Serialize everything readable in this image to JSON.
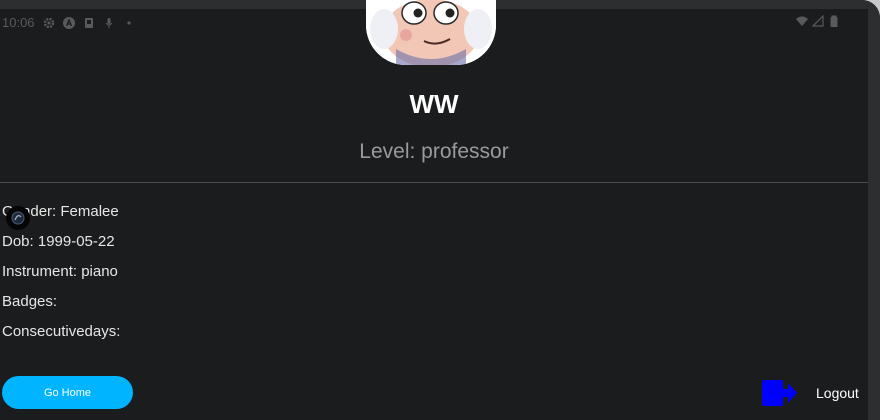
{
  "statusbar": {
    "time": "10:06",
    "icons_left": [
      "gear-icon",
      "a-circle-icon",
      "square-icon",
      "mic-icon",
      "dot-icon"
    ],
    "icons_right": [
      "wifi-icon",
      "signal-icon",
      "battery-icon"
    ]
  },
  "profile": {
    "username": "WW",
    "level": "Level: professor"
  },
  "info": {
    "gender": "Gender: Femalee",
    "dob": "Dob: 1999-05-22",
    "instrument": "Instrument: piano",
    "badges": "Badges:",
    "consecutive_days": "Consecutivedays:"
  },
  "actions": {
    "go_home_label": "Go Home",
    "logout_label": "Logout"
  },
  "colors": {
    "background": "#1b1c1e",
    "go_home_button": "#00b4ff",
    "logout_icon": "#0000ff",
    "text_primary": "#ffffff",
    "text_muted": "#9a9a9a"
  }
}
